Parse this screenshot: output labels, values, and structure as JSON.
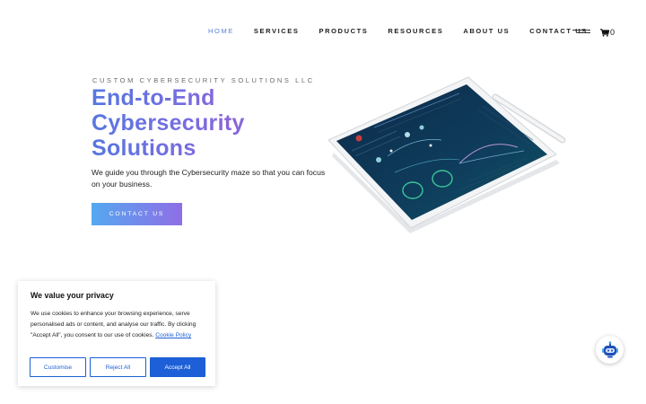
{
  "nav": {
    "items": [
      {
        "label": "HOME",
        "active": true
      },
      {
        "label": "SERVICES",
        "active": false
      },
      {
        "label": "PRODUCTS",
        "active": false
      },
      {
        "label": "RESOURCES",
        "active": false
      },
      {
        "label": "ABOUT US",
        "active": false
      },
      {
        "label": "CONTACT US",
        "active": false
      }
    ],
    "cart_count": "0",
    "icons": [
      "hamburger-menu-icon",
      "cart-icon"
    ]
  },
  "hero": {
    "eyebrow": "CUSTOM CYBERSECURITY SOLUTIONS LLC",
    "headline_lines": [
      "End-to-End",
      "Cybersecurity",
      "Solutions"
    ],
    "subtext": "We guide you through the Cybersecurity maze so that you can focus on your business.",
    "cta_label": "CONTACT US",
    "colors": {
      "gradient_start": "#55a8f0",
      "gradient_end": "#8f6ee6",
      "headline_blue": "#5578e0",
      "headline_purple": "#8a63d8"
    }
  },
  "cookie_banner": {
    "title": "We value your privacy",
    "text": "We use cookies to enhance your browsing experience, serve personalised ads or content, and analyse our traffic. By clicking \"Accept All\", you consent to our use of cookies.",
    "link_label": "Cookie Policy",
    "buttons": {
      "customise": "Customise",
      "reject": "Reject All",
      "accept": "Accept All"
    },
    "accent_color": "#1c5fd6"
  },
  "chatbot": {
    "icon": "chatbot-icon"
  }
}
